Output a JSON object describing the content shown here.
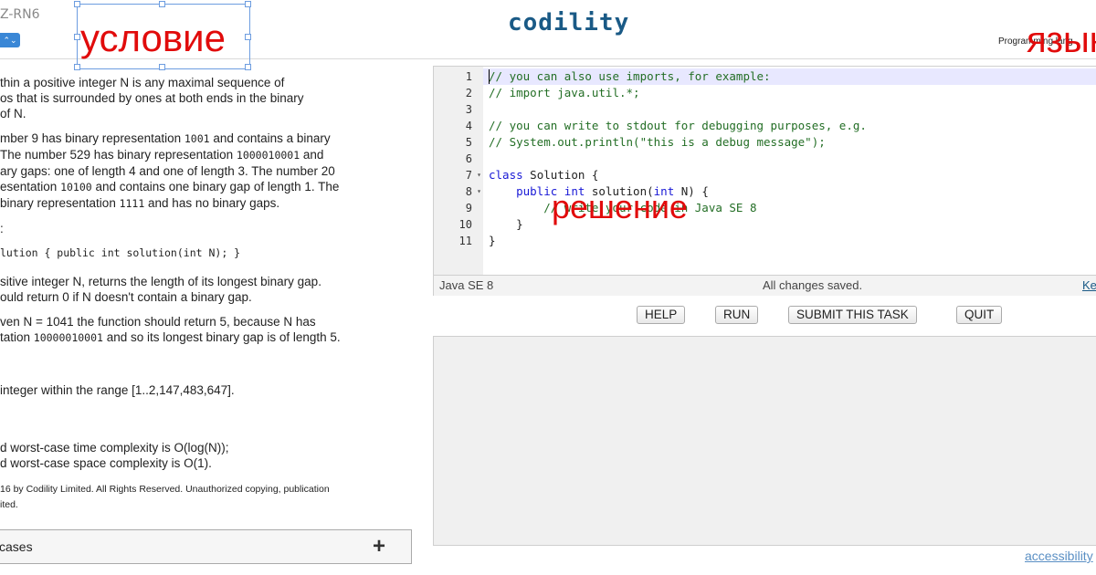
{
  "header": {
    "task_id": "Z-RN6",
    "lang_select_arrow": "⌃⌄",
    "logo": "codility",
    "programming_language_label": "Programming lang"
  },
  "overlays": {
    "uslovie": "условие",
    "yazyk": "язык",
    "reshenie": "решение"
  },
  "description": {
    "p1": "thin a positive integer N is any maximal sequence of\nos that is surrounded by ones at both ends in the binary\nof N.",
    "p2_a": "mber 9 has binary representation ",
    "p2_code1": "1001",
    "p2_b": " and contains a binary\n The number 529 has binary representation ",
    "p2_code2": "1000010001",
    "p2_c": " and\nary gaps: one of length 4 and one of length 3. The number 20\nesentation ",
    "p2_code3": "10100",
    "p2_d": " and contains one binary gap of length 1. The\nbinary representation ",
    "p2_code4": "1111",
    "p2_e": " and has no binary gaps.",
    "p3": ":",
    "signature": "lution { public int solution(int N); }",
    "p4": "sitive integer N, returns the length of its longest binary gap.\nould return 0 if N doesn't contain a binary gap.",
    "p5_a": "ven N = 1041 the function should return 5, because N has\ntation ",
    "p5_code": "10000010001",
    "p5_b": " and so its longest binary gap is of length 5.",
    "p6": "integer within the range [1..2,147,483,647].",
    "p7": "d worst-case time complexity is O(log(N));\nd worst-case space complexity is O(1).",
    "copyright": "16 by Codility Limited. All Rights Reserved. Unauthorized copying, publication\nited."
  },
  "test_cases": {
    "label": "cases",
    "plus_icon": "+"
  },
  "editor": {
    "lines": [
      {
        "num": "1",
        "fold": "",
        "text": "// you can also use imports, for example:"
      },
      {
        "num": "2",
        "fold": "",
        "text": "// import java.util.*;"
      },
      {
        "num": "3",
        "fold": "",
        "text": ""
      },
      {
        "num": "4",
        "fold": "",
        "text": "// you can write to stdout for debugging purposes, e.g."
      },
      {
        "num": "5",
        "fold": "",
        "text": "// System.out.println(\"this is a debug message\");"
      },
      {
        "num": "6",
        "fold": "",
        "text": ""
      },
      {
        "num": "7",
        "fold": "▾",
        "text": "class Solution {"
      },
      {
        "num": "8",
        "fold": "▾",
        "text": "    public int solution(int N) {"
      },
      {
        "num": "9",
        "fold": "",
        "text": "        // write your code in Java SE 8"
      },
      {
        "num": "10",
        "fold": "",
        "text": "    }"
      },
      {
        "num": "11",
        "fold": "",
        "text": "}"
      }
    ],
    "status_language": "Java SE 8",
    "status_message": "All changes saved.",
    "status_keyboard": "Ke"
  },
  "buttons": {
    "help": "HELP",
    "run": "RUN",
    "submit": "SUBMIT THIS TASK",
    "quit": "QUIT"
  },
  "footer": {
    "accessibility": "accessibility"
  },
  "colors": {
    "overlay_red": "#e10b0b",
    "logo_blue": "#1a5a86",
    "comment_green": "#236e25",
    "keyword_blue": "#1818d6"
  }
}
